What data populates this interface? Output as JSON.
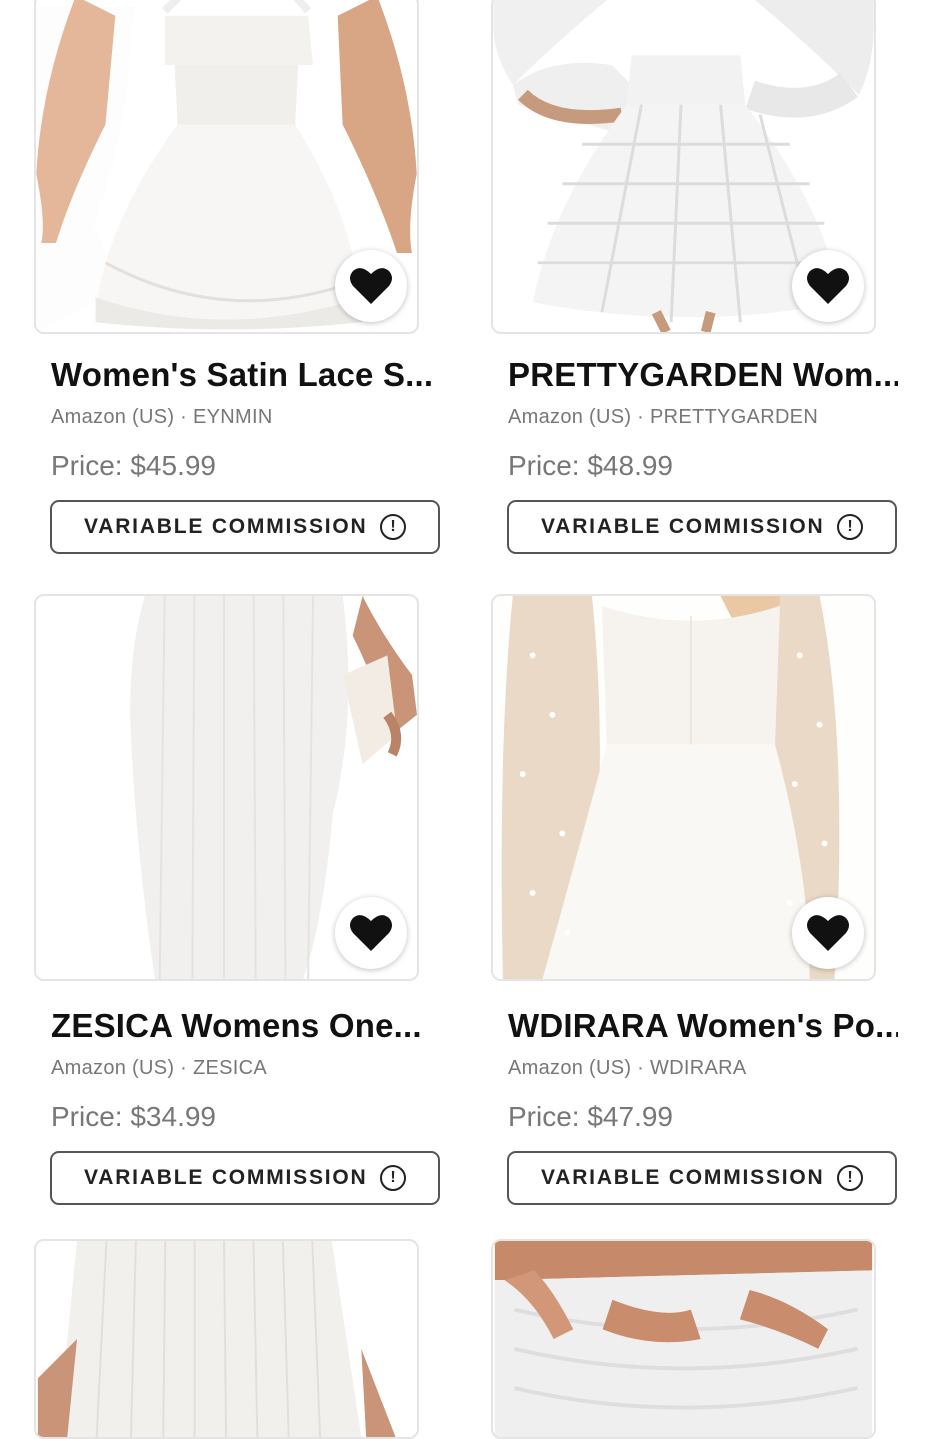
{
  "products": [
    {
      "title": "Women's Satin Lace S...",
      "merchant": "Amazon (US) · EYNMIN",
      "price": "Price: $45.99",
      "commission_label": "VARIABLE COMMISSION",
      "info_glyph": "!",
      "favorite_icon": "heart-icon"
    },
    {
      "title": "PRETTYGARDEN Wom...",
      "merchant": "Amazon (US) · PRETTYGARDEN",
      "price": "Price: $48.99",
      "commission_label": "VARIABLE COMMISSION",
      "info_glyph": "!",
      "favorite_icon": "heart-icon"
    },
    {
      "title": "ZESICA Womens One...",
      "merchant": "Amazon (US) · ZESICA",
      "price": "Price: $34.99",
      "commission_label": "VARIABLE COMMISSION",
      "info_glyph": "!",
      "favorite_icon": "heart-icon"
    },
    {
      "title": "WDIRARA Women's Po...",
      "merchant": "Amazon (US) · WDIRARA",
      "price": "Price: $47.99",
      "commission_label": "VARIABLE COMMISSION",
      "info_glyph": "!",
      "favorite_icon": "heart-icon"
    },
    {
      "title": "",
      "merchant": "",
      "price": "",
      "commission_label": "",
      "info_glyph": "",
      "favorite_icon": ""
    },
    {
      "title": "",
      "merchant": "",
      "price": "",
      "commission_label": "",
      "info_glyph": "",
      "favorite_icon": ""
    }
  ],
  "colors": {
    "border": "#e4e4e4",
    "text": "#111111",
    "muted": "#777777",
    "button_border": "#555555"
  }
}
